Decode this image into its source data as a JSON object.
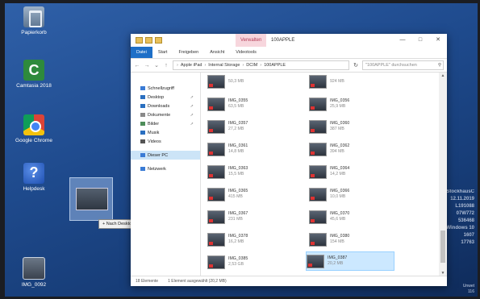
{
  "desktop": {
    "icons": [
      {
        "label": "Papierkorb",
        "icon": "recycle-bin-icon"
      },
      {
        "label": "Camtasia 2018",
        "icon": "camtasia-icon"
      },
      {
        "label": "Google Chrome",
        "icon": "chrome-icon"
      },
      {
        "label": "Helpdesk",
        "icon": "help-icon"
      },
      {
        "label": "IMG_0092",
        "icon": "image-file-icon"
      }
    ],
    "drag_tooltip": "+ Nach Desktop kopieren",
    "watermark": [
      "StockhausC",
      "12.11.2019",
      "L191088",
      "07W772",
      "536468",
      "Windows 10",
      "1607",
      "17763",
      "Unwet",
      "116"
    ]
  },
  "window": {
    "title": "100APPLE",
    "context_tab": "Verwalten",
    "ribbon_tabs": [
      "Datei",
      "Start",
      "Freigeben",
      "Ansicht",
      "Videotools"
    ],
    "address_path": [
      "Apple iPad",
      "Internal Storage",
      "DCIM",
      "100APPLE"
    ],
    "search_placeholder": "\"100APPLE\" durchsuchen",
    "nav_pane": [
      {
        "label": "Schnellzugriff",
        "pinned": false
      },
      {
        "label": "Desktop",
        "pinned": true
      },
      {
        "label": "Downloads",
        "pinned": true
      },
      {
        "label": "Dokumente",
        "pinned": true
      },
      {
        "label": "Bilder",
        "pinned": true
      },
      {
        "label": "Musik",
        "pinned": false
      },
      {
        "label": "Videos",
        "pinned": false
      },
      {
        "label": "Dieser PC",
        "pinned": false
      },
      {
        "label": "Netzwerk",
        "pinned": false
      }
    ],
    "files": [
      {
        "name": "",
        "size": "50,3 MB"
      },
      {
        "name": "",
        "size": "924 MB"
      },
      {
        "name": "IMG_0355",
        "size": "63,5 MB"
      },
      {
        "name": "IMG_0356",
        "size": "25,9 MB"
      },
      {
        "name": "IMG_0357",
        "size": "27,2 MB"
      },
      {
        "name": "IMG_0360",
        "size": "387 MB"
      },
      {
        "name": "IMG_0361",
        "size": "14,8 MB"
      },
      {
        "name": "IMG_0362",
        "size": "394 MB"
      },
      {
        "name": "IMG_0363",
        "size": "15,5 MB"
      },
      {
        "name": "IMG_0364",
        "size": "14,2 MB"
      },
      {
        "name": "IMG_0365",
        "size": "415 MB"
      },
      {
        "name": "IMG_0366",
        "size": "10,0 MB"
      },
      {
        "name": "IMG_0367",
        "size": "231 MB"
      },
      {
        "name": "IMG_0370",
        "size": "45,6 MB"
      },
      {
        "name": "IMG_0378",
        "size": "16,2 MB"
      },
      {
        "name": "IMG_0380",
        "size": "154 MB"
      },
      {
        "name": "IMG_0385",
        "size": "2,53 GB"
      },
      {
        "name": "IMG_0387",
        "size": "20,2 MB"
      }
    ],
    "selected_file": "IMG_0387",
    "status": {
      "count": "18 Elemente",
      "selection": "1 Element ausgewählt (20,2 MB)"
    }
  }
}
